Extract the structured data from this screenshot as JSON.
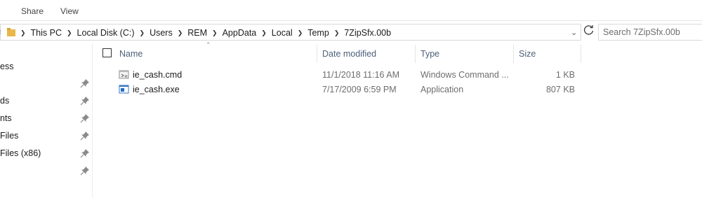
{
  "ribbon": {
    "tabs": [
      "Share",
      "View"
    ]
  },
  "address": {
    "crumbs": [
      "This PC",
      "Local Disk (C:)",
      "Users",
      "REM",
      "AppData",
      "Local",
      "Temp",
      "7ZipSfx.00b"
    ]
  },
  "search": {
    "placeholder": "Search 7ZipSfx.00b"
  },
  "nav_pane": {
    "items": [
      {
        "label": "ess",
        "pinned": false
      },
      {
        "label": "",
        "pinned": true
      },
      {
        "label": "ds",
        "pinned": true
      },
      {
        "label": "nts",
        "pinned": true
      },
      {
        "label": "Files",
        "pinned": true
      },
      {
        "label": "Files (x86)",
        "pinned": true
      },
      {
        "label": "",
        "pinned": true
      }
    ]
  },
  "columns": {
    "name": "Name",
    "date": "Date modified",
    "type": "Type",
    "size": "Size"
  },
  "files": [
    {
      "name": "ie_cash.cmd",
      "date": "11/1/2018 11:16 AM",
      "type": "Windows Command ...",
      "size": "1 KB",
      "icon": "cmd-file-icon"
    },
    {
      "name": "ie_cash.exe",
      "date": "7/17/2009 6:59 PM",
      "type": "Application",
      "size": "807 KB",
      "icon": "exe-file-icon"
    }
  ],
  "colors": {
    "header_text": "#4c607a",
    "folder": "#e8b84a",
    "exe_icon": "#1e6fc8"
  }
}
